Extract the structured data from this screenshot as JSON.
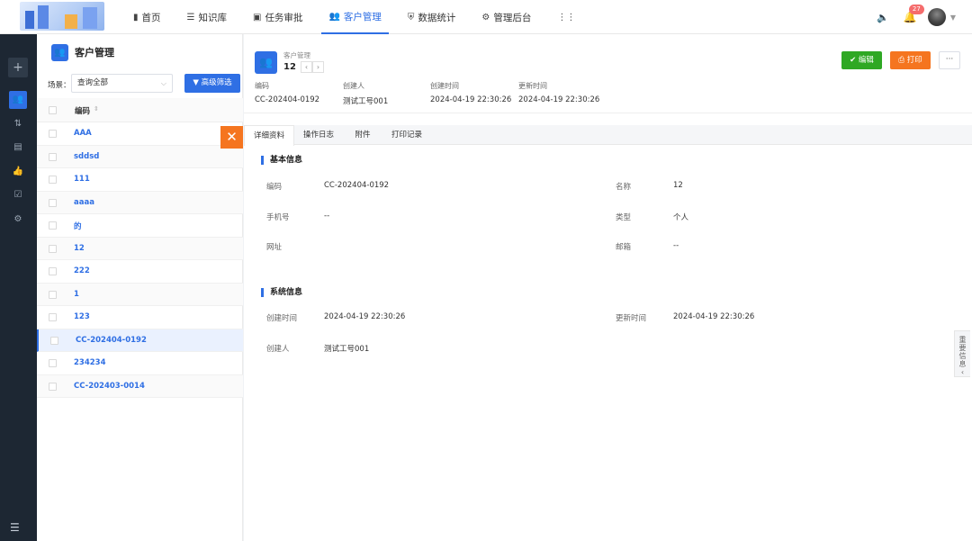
{
  "nav": {
    "items": [
      {
        "icon": "building-icon",
        "glyph": "▮",
        "label": "首页"
      },
      {
        "icon": "list-icon",
        "glyph": "☰",
        "label": "知识库"
      },
      {
        "icon": "briefcase-icon",
        "glyph": "▣",
        "label": "任务审批"
      },
      {
        "icon": "users-icon",
        "glyph": "👥",
        "label": "客户管理"
      },
      {
        "icon": "shield-icon",
        "glyph": "⛨",
        "label": "数据统计"
      },
      {
        "icon": "gear-icon",
        "glyph": "⚙",
        "label": "管理后台"
      },
      {
        "icon": "grid-icon",
        "glyph": "⋮⋮",
        "label": ""
      }
    ],
    "active_index": 3,
    "notification_count": "27"
  },
  "list": {
    "title": "客户管理",
    "scene_label": "场景：",
    "scene_value": "查询全部",
    "advanced_filter": "高级筛选",
    "column_header": "编码",
    "rows": [
      "AAA",
      "sddsd",
      "111",
      "aaaa",
      "的",
      "12",
      "222",
      "1",
      "123",
      "CC-202404-0192",
      "234234",
      "CC-202403-0014"
    ],
    "selected_index": 9
  },
  "detail": {
    "module": "客户管理",
    "number": "12",
    "meta": [
      {
        "key": "编码",
        "value": "CC-202404-0192"
      },
      {
        "key": "创建人",
        "value": "测试工号001"
      },
      {
        "key": "创建时间",
        "value": "2024-04-19 22:30:26"
      },
      {
        "key": "更新时间",
        "value": "2024-04-19 22:30:26"
      }
    ],
    "edit_label": "编辑",
    "print_label": "打印",
    "more_label": "···",
    "tabs": [
      "详细资料",
      "操作日志",
      "附件",
      "打印记录"
    ],
    "active_tab": 0,
    "basic": {
      "title": "基本信息",
      "fields": [
        {
          "label": "编码",
          "value": "CC-202404-0192"
        },
        {
          "label": "名称",
          "value": "12"
        },
        {
          "label": "手机号",
          "value": "--"
        },
        {
          "label": "类型",
          "value": "个人"
        },
        {
          "label": "网址",
          "value": ""
        },
        {
          "label": "邮箱",
          "value": "--"
        }
      ]
    },
    "system": {
      "title": "系统信息",
      "fields": [
        {
          "label": "创建时间",
          "value": "2024-04-19 22:30:26"
        },
        {
          "label": "更新时间",
          "value": "2024-04-19 22:30:26"
        },
        {
          "label": "创建人",
          "value": "测试工号001"
        }
      ]
    },
    "side_tab": "重要信息"
  }
}
